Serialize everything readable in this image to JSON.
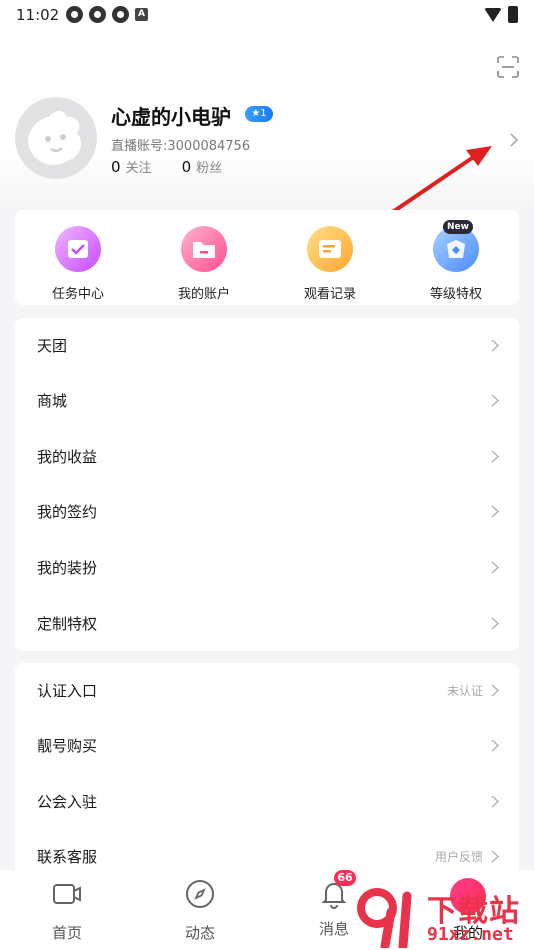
{
  "status_bar": {
    "time": "11:02",
    "left_icons": [
      "app-icon",
      "app-icon",
      "app-icon",
      "a-icon"
    ],
    "a_letter": "A"
  },
  "profile": {
    "nickname": "心虚的小电驴",
    "level": "1",
    "account_id": "直播账号:3000084756",
    "following_count": "0",
    "following_label": "关注",
    "fans_count": "0",
    "fans_label": "粉丝"
  },
  "quick_actions": [
    {
      "label": "任务中心",
      "icon": "calendar-check-icon",
      "color": "#c54bff"
    },
    {
      "label": "我的账户",
      "icon": "wallet-folder-icon",
      "color": "#ff4d8d"
    },
    {
      "label": "观看记录",
      "icon": "history-list-icon",
      "color": "#ffa62b"
    },
    {
      "label": "等级特权",
      "icon": "privilege-crown-icon",
      "color": "#4a8cff",
      "badge": "New"
    }
  ],
  "menu_group_1": [
    {
      "label": "天团"
    },
    {
      "label": "商城"
    },
    {
      "label": "我的收益"
    },
    {
      "label": "我的签约"
    },
    {
      "label": "我的装扮"
    },
    {
      "label": "定制特权"
    }
  ],
  "menu_group_2": [
    {
      "label": "认证入口",
      "sub": "未认证"
    },
    {
      "label": "靓号购买",
      "sub": ""
    },
    {
      "label": "公会入驻",
      "sub": ""
    },
    {
      "label": "联系客服",
      "sub": "用户反馈"
    }
  ],
  "bottom_nav": [
    {
      "label": "首页",
      "icon": "video-camera-icon"
    },
    {
      "label": "动态",
      "icon": "compass-icon"
    },
    {
      "label": "消息",
      "icon": "bell-icon",
      "badge": "66"
    },
    {
      "label": "我的",
      "icon": "me-avatar-icon"
    }
  ],
  "watermark": {
    "text": "下载站",
    "domain": "91xz.net"
  },
  "colors": {
    "accent": "#ff2d55",
    "annotation_arrow": "#e0201e",
    "level_badge": "#1a7cf0"
  }
}
